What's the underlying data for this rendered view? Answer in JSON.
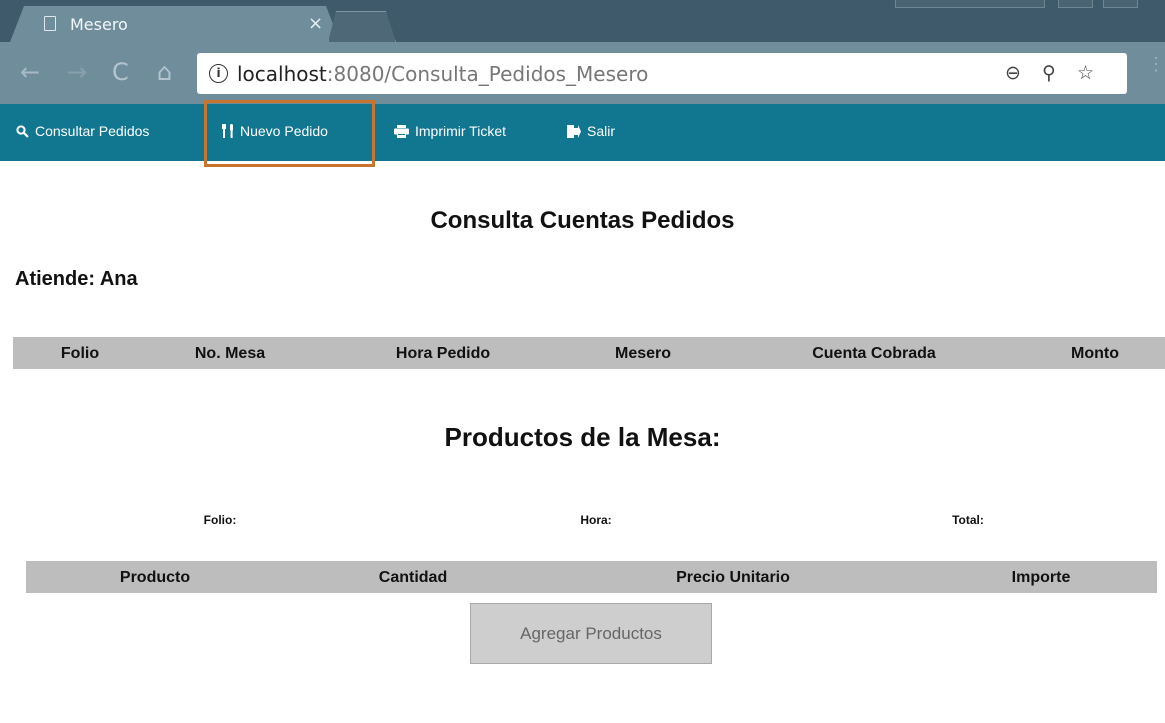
{
  "browser": {
    "tab_title": "Mesero",
    "tab_close": "×",
    "url_host": "localhost",
    "url_path": ":8080/Consulta_Pedidos_Mesero",
    "icons": [
      "page-icon",
      "close-icon",
      "back-icon",
      "forward-icon",
      "reload-icon",
      "home-icon",
      "info-icon",
      "zoom-icon",
      "paint-icon",
      "star-icon",
      "menu-icon"
    ]
  },
  "nav": {
    "items": [
      {
        "label": "Consultar Pedidos",
        "icon": "search-icon"
      },
      {
        "label": "Nuevo Pedido",
        "icon": "utensils-icon"
      },
      {
        "label": "Imprimir Ticket",
        "icon": "print-icon"
      },
      {
        "label": "Salir",
        "icon": "sign-out-icon"
      }
    ],
    "highlighted": "Nuevo Pedido",
    "background": "#117690",
    "highlight_color": "#c9742e"
  },
  "main": {
    "title": "Consulta Cuentas Pedidos",
    "atiende_label": "Atiende:",
    "atiende_name": "Ana",
    "orders_table": {
      "columns": [
        "Folio",
        "No. Mesa",
        "Hora Pedido",
        "Mesero",
        "Cuenta Cobrada",
        "Monto"
      ],
      "rows": []
    },
    "products_title": "Productos de la Mesa:",
    "folio_label": "Folio:",
    "hora_label": "Hora:",
    "total_label": "Total:",
    "products_table": {
      "columns": [
        "Producto",
        "Cantidad",
        "Precio Unitario",
        "Importe"
      ],
      "rows": []
    },
    "add_button": "Agregar Productos"
  }
}
